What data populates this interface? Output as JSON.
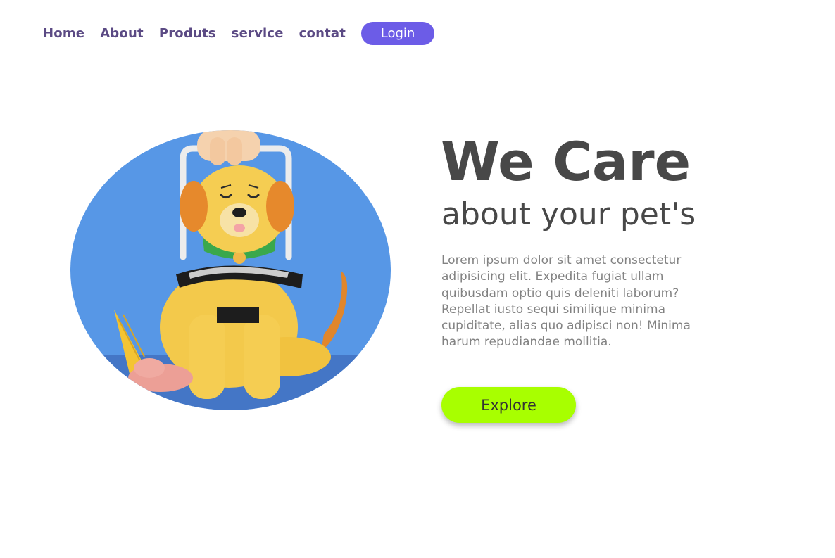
{
  "nav": {
    "links": [
      "Home",
      "About",
      "Produts",
      "service",
      "contat"
    ],
    "login_label": "Login"
  },
  "hero": {
    "title": "We Care",
    "subtitle": "about your pet's",
    "description": "Lorem ipsum dolor sit amet consectetur adipisicing elit. Expedita fugiat ullam quibusdam optio quis deleniti laborum? Repellat iusto sequi similique minima cupiditate, alias quo adipisci non! Minima harum repudiandae mollitia.",
    "explore_label": "Explore",
    "image_icon": "dog-illustration"
  },
  "colors": {
    "nav_text": "#5b4a84",
    "login_bg": "#6c5ce7",
    "explore_bg": "#a8ff00",
    "heading": "#484848",
    "body_text": "#828282",
    "image_bg": "#5797e6"
  }
}
